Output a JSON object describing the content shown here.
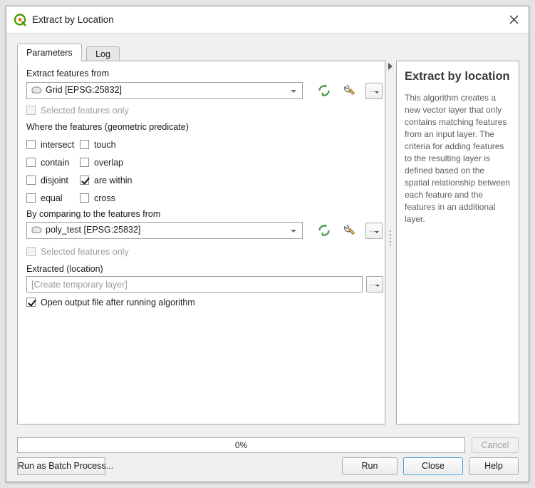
{
  "window": {
    "title": "Extract by Location",
    "app_icon": "qgis-logo-icon",
    "close_icon": "close-icon"
  },
  "tabs": [
    {
      "label": "Parameters",
      "active": true
    },
    {
      "label": "Log",
      "active": false
    }
  ],
  "parameters": {
    "input_label": "Extract features from",
    "input_layer": "Grid [EPSG:25832]",
    "input_selected_only": {
      "label": "Selected features only",
      "checked": false,
      "disabled": true
    },
    "predicate_label": "Where the features (geometric predicate)",
    "predicates": [
      {
        "label": "intersect",
        "checked": false
      },
      {
        "label": "touch",
        "checked": false
      },
      {
        "label": "contain",
        "checked": false
      },
      {
        "label": "overlap",
        "checked": false
      },
      {
        "label": "disjoint",
        "checked": false
      },
      {
        "label": "are within",
        "checked": true
      },
      {
        "label": "equal",
        "checked": false
      },
      {
        "label": "cross",
        "checked": false
      }
    ],
    "compare_label": "By comparing to the features from",
    "compare_layer": "poly_test [EPSG:25832]",
    "compare_selected_only": {
      "label": "Selected features only",
      "checked": false,
      "disabled": true
    },
    "output_label": "Extracted (location)",
    "output_value": "",
    "output_placeholder": "[Create temporary layer]",
    "open_output": {
      "label": "Open output file after running algorithm",
      "checked": true
    },
    "icons": {
      "iterate": "iterate-refresh-icon",
      "advanced": "wrench-icon",
      "browse": "ellipsis-dropdown-button",
      "layer": "vector-polygon-layer-icon",
      "dropdown": "chevron-down-icon"
    }
  },
  "help": {
    "title": "Extract by location",
    "body": "This algorithm creates a new vector layer that only contains matching features from an input layer. The criteria for adding features to the resulting layer is defined based on the spatial relationship between each feature and the features in an additional layer."
  },
  "footer": {
    "progress_text": "0%",
    "progress_percent": 0,
    "cancel_label": "Cancel",
    "cancel_disabled": true,
    "batch_label": "Run as Batch Process...",
    "run_label": "Run",
    "close_label": "Close",
    "help_label": "Help"
  },
  "colors": {
    "accent_blue": "#3f9bdc",
    "qgis_green": "#4e9a06",
    "qgis_orange": "#e87d0d",
    "dialog_bg": "#f0f0f0",
    "panel_bg": "#ffffff"
  }
}
